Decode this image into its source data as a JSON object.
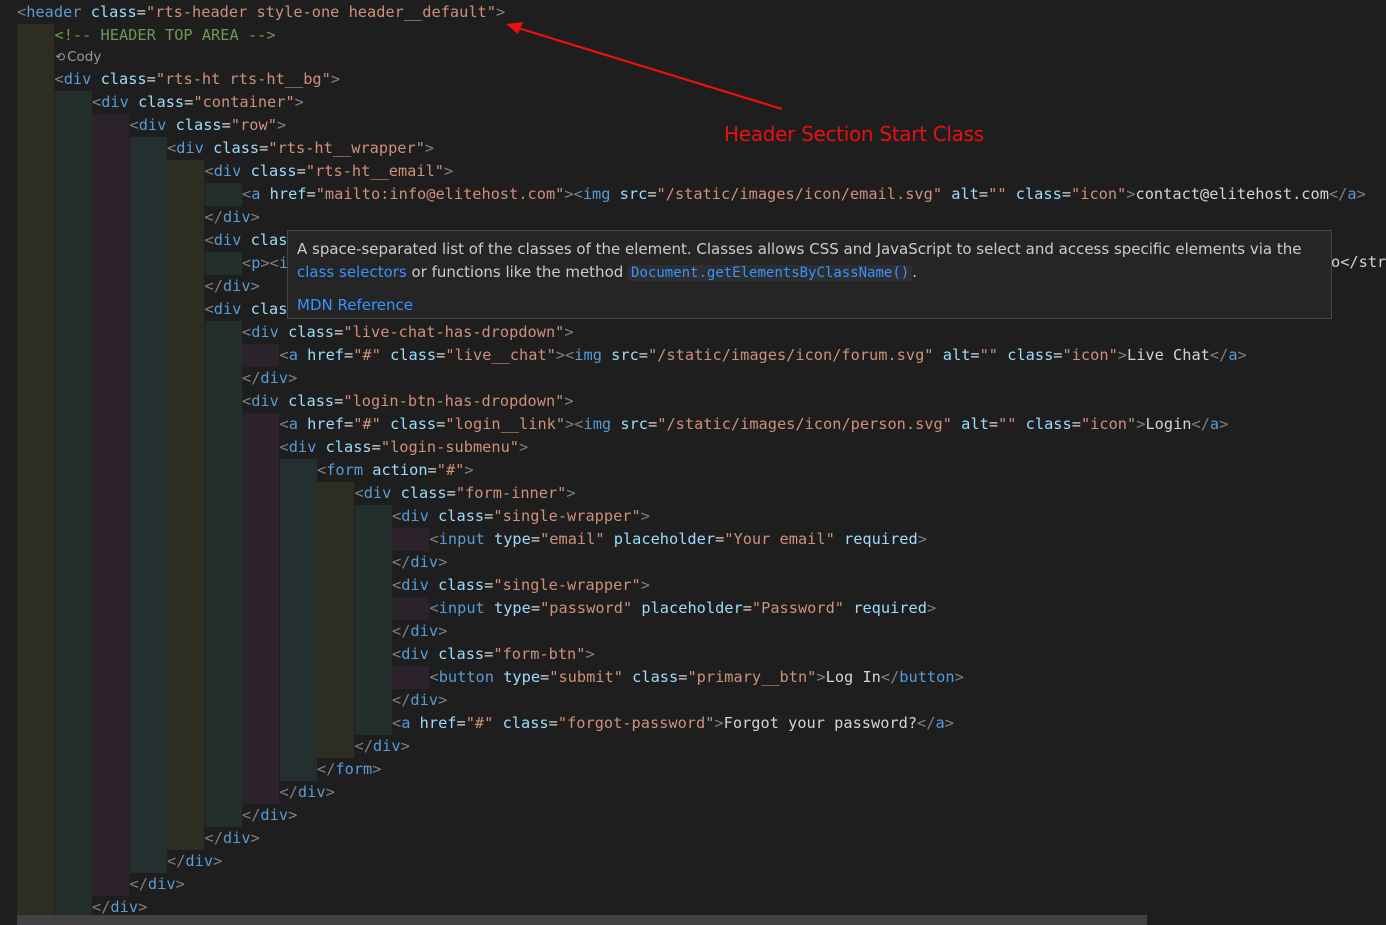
{
  "code_lines": [
    {
      "indent": 0,
      "tokens": [
        [
          "b",
          "<"
        ],
        [
          "t",
          "header"
        ],
        [
          "x",
          " "
        ],
        [
          "a",
          "class"
        ],
        [
          "x",
          "="
        ],
        [
          "s",
          "\"rts-header style-one header__default\""
        ],
        [
          "b",
          ">"
        ]
      ]
    },
    {
      "indent": 1,
      "tokens": [
        [
          "c",
          "<!-- HEADER TOP AREA -->"
        ]
      ]
    },
    {
      "indent": 1,
      "tokens": [
        [
          "b",
          "<"
        ],
        [
          "t",
          "div"
        ],
        [
          "x",
          " "
        ],
        [
          "a",
          "class"
        ],
        [
          "x",
          "="
        ],
        [
          "s",
          "\"rts-ht rts-ht__bg\""
        ],
        [
          "b",
          ">"
        ]
      ]
    },
    {
      "indent": 2,
      "tokens": [
        [
          "b",
          "<"
        ],
        [
          "t",
          "div"
        ],
        [
          "x",
          " "
        ],
        [
          "a",
          "class"
        ],
        [
          "x",
          "="
        ],
        [
          "s",
          "\"container\""
        ],
        [
          "b",
          ">"
        ]
      ]
    },
    {
      "indent": 3,
      "tokens": [
        [
          "b",
          "<"
        ],
        [
          "t",
          "div"
        ],
        [
          "x",
          " "
        ],
        [
          "a",
          "class"
        ],
        [
          "x",
          "="
        ],
        [
          "s",
          "\"row\""
        ],
        [
          "b",
          ">"
        ]
      ]
    },
    {
      "indent": 4,
      "tokens": [
        [
          "b",
          "<"
        ],
        [
          "t",
          "div"
        ],
        [
          "x",
          " "
        ],
        [
          "a",
          "class"
        ],
        [
          "x",
          "="
        ],
        [
          "s",
          "\"rts-ht__wrapper\""
        ],
        [
          "b",
          ">"
        ]
      ]
    },
    {
      "indent": 5,
      "tokens": [
        [
          "b",
          "<"
        ],
        [
          "t",
          "div"
        ],
        [
          "x",
          " "
        ],
        [
          "a",
          "class"
        ],
        [
          "x",
          "="
        ],
        [
          "s",
          "\"rts-ht__email\""
        ],
        [
          "b",
          ">"
        ]
      ]
    },
    {
      "indent": 6,
      "tokens": [
        [
          "b",
          "<"
        ],
        [
          "t",
          "a"
        ],
        [
          "x",
          " "
        ],
        [
          "a",
          "href"
        ],
        [
          "x",
          "="
        ],
        [
          "s",
          "\"mailto:info@elitehost.com\""
        ],
        [
          "b",
          "><"
        ],
        [
          "t",
          "img"
        ],
        [
          "x",
          " "
        ],
        [
          "a",
          "src"
        ],
        [
          "x",
          "="
        ],
        [
          "s",
          "\"/static/images/icon/email.svg\""
        ],
        [
          "x",
          " "
        ],
        [
          "a",
          "alt"
        ],
        [
          "x",
          "="
        ],
        [
          "s",
          "\"\""
        ],
        [
          "x",
          " "
        ],
        [
          "a",
          "class"
        ],
        [
          "x",
          "="
        ],
        [
          "s",
          "\"icon\""
        ],
        [
          "b",
          ">"
        ],
        [
          "e",
          "contact@elitehost.com"
        ],
        [
          "b",
          "</"
        ],
        [
          "t",
          "a"
        ],
        [
          "b",
          ">"
        ]
      ]
    },
    {
      "indent": 5,
      "tokens": [
        [
          "b",
          "</"
        ],
        [
          "t",
          "div"
        ],
        [
          "b",
          ">"
        ]
      ]
    },
    {
      "indent": 5,
      "tokens": [
        [
          "b",
          "<"
        ],
        [
          "t",
          "div"
        ],
        [
          "x",
          " "
        ],
        [
          "a",
          "clas"
        ]
      ]
    },
    {
      "indent": 6,
      "tokens": [
        [
          "b",
          "<"
        ],
        [
          "t",
          "p"
        ],
        [
          "b",
          "><"
        ],
        [
          "t",
          "i"
        ]
      ]
    },
    {
      "indent": 5,
      "tokens": [
        [
          "b",
          "</"
        ],
        [
          "t",
          "div"
        ],
        [
          "b",
          ">"
        ]
      ]
    },
    {
      "indent": 5,
      "tokens": [
        [
          "b",
          "<"
        ],
        [
          "t",
          "div"
        ],
        [
          "x",
          " "
        ],
        [
          "a",
          "clas"
        ]
      ]
    },
    {
      "indent": 6,
      "tokens": [
        [
          "b",
          "<"
        ],
        [
          "t",
          "div"
        ],
        [
          "x",
          " "
        ],
        [
          "a",
          "class"
        ],
        [
          "x",
          "="
        ],
        [
          "s",
          "\"live-chat-has-dropdown\""
        ],
        [
          "b",
          ">"
        ]
      ]
    },
    {
      "indent": 7,
      "tokens": [
        [
          "b",
          "<"
        ],
        [
          "t",
          "a"
        ],
        [
          "x",
          " "
        ],
        [
          "a",
          "href"
        ],
        [
          "x",
          "="
        ],
        [
          "s",
          "\"#\""
        ],
        [
          "x",
          " "
        ],
        [
          "a",
          "class"
        ],
        [
          "x",
          "="
        ],
        [
          "s",
          "\"live__chat\""
        ],
        [
          "b",
          "><"
        ],
        [
          "t",
          "img"
        ],
        [
          "x",
          " "
        ],
        [
          "a",
          "src"
        ],
        [
          "x",
          "="
        ],
        [
          "s",
          "\"/static/images/icon/forum.svg\""
        ],
        [
          "x",
          " "
        ],
        [
          "a",
          "alt"
        ],
        [
          "x",
          "="
        ],
        [
          "s",
          "\"\""
        ],
        [
          "x",
          " "
        ],
        [
          "a",
          "class"
        ],
        [
          "x",
          "="
        ],
        [
          "s",
          "\"icon\""
        ],
        [
          "b",
          ">"
        ],
        [
          "e",
          "Live Chat"
        ],
        [
          "b",
          "</"
        ],
        [
          "t",
          "a"
        ],
        [
          "b",
          ">"
        ]
      ]
    },
    {
      "indent": 6,
      "tokens": [
        [
          "b",
          "</"
        ],
        [
          "t",
          "div"
        ],
        [
          "b",
          ">"
        ]
      ]
    },
    {
      "indent": 6,
      "tokens": [
        [
          "b",
          "<"
        ],
        [
          "t",
          "div"
        ],
        [
          "x",
          " "
        ],
        [
          "a",
          "class"
        ],
        [
          "x",
          "="
        ],
        [
          "s",
          "\"login-btn-has-dropdown\""
        ],
        [
          "b",
          ">"
        ]
      ]
    },
    {
      "indent": 7,
      "tokens": [
        [
          "b",
          "<"
        ],
        [
          "t",
          "a"
        ],
        [
          "x",
          " "
        ],
        [
          "a",
          "href"
        ],
        [
          "x",
          "="
        ],
        [
          "s",
          "\"#\""
        ],
        [
          "x",
          " "
        ],
        [
          "a",
          "class"
        ],
        [
          "x",
          "="
        ],
        [
          "s",
          "\"login__link\""
        ],
        [
          "b",
          "><"
        ],
        [
          "t",
          "img"
        ],
        [
          "x",
          " "
        ],
        [
          "a",
          "src"
        ],
        [
          "x",
          "="
        ],
        [
          "s",
          "\"/static/images/icon/person.svg\""
        ],
        [
          "x",
          " "
        ],
        [
          "a",
          "alt"
        ],
        [
          "x",
          "="
        ],
        [
          "s",
          "\"\""
        ],
        [
          "x",
          " "
        ],
        [
          "a",
          "class"
        ],
        [
          "x",
          "="
        ],
        [
          "s",
          "\"icon\""
        ],
        [
          "b",
          ">"
        ],
        [
          "e",
          "Login"
        ],
        [
          "b",
          "</"
        ],
        [
          "t",
          "a"
        ],
        [
          "b",
          ">"
        ]
      ]
    },
    {
      "indent": 7,
      "tokens": [
        [
          "b",
          "<"
        ],
        [
          "t",
          "div"
        ],
        [
          "x",
          " "
        ],
        [
          "a",
          "class"
        ],
        [
          "x",
          "="
        ],
        [
          "s",
          "\"login-submenu\""
        ],
        [
          "b",
          ">"
        ]
      ]
    },
    {
      "indent": 8,
      "tokens": [
        [
          "b",
          "<"
        ],
        [
          "t",
          "form"
        ],
        [
          "x",
          " "
        ],
        [
          "a",
          "action"
        ],
        [
          "x",
          "="
        ],
        [
          "s",
          "\"#\""
        ],
        [
          "b",
          ">"
        ]
      ]
    },
    {
      "indent": 9,
      "tokens": [
        [
          "b",
          "<"
        ],
        [
          "t",
          "div"
        ],
        [
          "x",
          " "
        ],
        [
          "a",
          "class"
        ],
        [
          "x",
          "="
        ],
        [
          "s",
          "\"form-inner\""
        ],
        [
          "b",
          ">"
        ]
      ]
    },
    {
      "indent": 10,
      "tokens": [
        [
          "b",
          "<"
        ],
        [
          "t",
          "div"
        ],
        [
          "x",
          " "
        ],
        [
          "a",
          "class"
        ],
        [
          "x",
          "="
        ],
        [
          "s",
          "\"single-wrapper\""
        ],
        [
          "b",
          ">"
        ]
      ]
    },
    {
      "indent": 11,
      "tokens": [
        [
          "b",
          "<"
        ],
        [
          "t",
          "input"
        ],
        [
          "x",
          " "
        ],
        [
          "a",
          "type"
        ],
        [
          "x",
          "="
        ],
        [
          "s",
          "\"email\""
        ],
        [
          "x",
          " "
        ],
        [
          "a",
          "placeholder"
        ],
        [
          "x",
          "="
        ],
        [
          "s",
          "\"Your email\""
        ],
        [
          "x",
          " "
        ],
        [
          "a",
          "required"
        ],
        [
          "b",
          ">"
        ]
      ]
    },
    {
      "indent": 10,
      "tokens": [
        [
          "b",
          "</"
        ],
        [
          "t",
          "div"
        ],
        [
          "b",
          ">"
        ]
      ]
    },
    {
      "indent": 10,
      "tokens": [
        [
          "b",
          "<"
        ],
        [
          "t",
          "div"
        ],
        [
          "x",
          " "
        ],
        [
          "a",
          "class"
        ],
        [
          "x",
          "="
        ],
        [
          "s",
          "\"single-wrapper\""
        ],
        [
          "b",
          ">"
        ]
      ]
    },
    {
      "indent": 11,
      "tokens": [
        [
          "b",
          "<"
        ],
        [
          "t",
          "input"
        ],
        [
          "x",
          " "
        ],
        [
          "a",
          "type"
        ],
        [
          "x",
          "="
        ],
        [
          "s",
          "\"password\""
        ],
        [
          "x",
          " "
        ],
        [
          "a",
          "placeholder"
        ],
        [
          "x",
          "="
        ],
        [
          "s",
          "\"Password\""
        ],
        [
          "x",
          " "
        ],
        [
          "a",
          "required"
        ],
        [
          "b",
          ">"
        ]
      ]
    },
    {
      "indent": 10,
      "tokens": [
        [
          "b",
          "</"
        ],
        [
          "t",
          "div"
        ],
        [
          "b",
          ">"
        ]
      ]
    },
    {
      "indent": 10,
      "tokens": [
        [
          "b",
          "<"
        ],
        [
          "t",
          "div"
        ],
        [
          "x",
          " "
        ],
        [
          "a",
          "class"
        ],
        [
          "x",
          "="
        ],
        [
          "s",
          "\"form-btn\""
        ],
        [
          "b",
          ">"
        ]
      ]
    },
    {
      "indent": 11,
      "tokens": [
        [
          "b",
          "<"
        ],
        [
          "t",
          "button"
        ],
        [
          "x",
          " "
        ],
        [
          "a",
          "type"
        ],
        [
          "x",
          "="
        ],
        [
          "s",
          "\"submit\""
        ],
        [
          "x",
          " "
        ],
        [
          "a",
          "class"
        ],
        [
          "x",
          "="
        ],
        [
          "s",
          "\"primary__btn\""
        ],
        [
          "b",
          ">"
        ],
        [
          "e",
          "Log In"
        ],
        [
          "b",
          "</"
        ],
        [
          "t",
          "button"
        ],
        [
          "b",
          ">"
        ]
      ]
    },
    {
      "indent": 10,
      "tokens": [
        [
          "b",
          "</"
        ],
        [
          "t",
          "div"
        ],
        [
          "b",
          ">"
        ]
      ]
    },
    {
      "indent": 10,
      "tokens": [
        [
          "b",
          "<"
        ],
        [
          "t",
          "a"
        ],
        [
          "x",
          " "
        ],
        [
          "a",
          "href"
        ],
        [
          "x",
          "="
        ],
        [
          "s",
          "\"#\""
        ],
        [
          "x",
          " "
        ],
        [
          "a",
          "class"
        ],
        [
          "x",
          "="
        ],
        [
          "s",
          "\"forgot-password\""
        ],
        [
          "b",
          ">"
        ],
        [
          "e",
          "Forgot your password?"
        ],
        [
          "b",
          "</"
        ],
        [
          "t",
          "a"
        ],
        [
          "b",
          ">"
        ]
      ]
    },
    {
      "indent": 9,
      "tokens": [
        [
          "b",
          "</"
        ],
        [
          "t",
          "div"
        ],
        [
          "b",
          ">"
        ]
      ]
    },
    {
      "indent": 8,
      "tokens": [
        [
          "b",
          "</"
        ],
        [
          "t",
          "form"
        ],
        [
          "b",
          ">"
        ]
      ]
    },
    {
      "indent": 7,
      "tokens": [
        [
          "b",
          "</"
        ],
        [
          "t",
          "div"
        ],
        [
          "b",
          ">"
        ]
      ]
    },
    {
      "indent": 6,
      "tokens": [
        [
          "b",
          "</"
        ],
        [
          "t",
          "div"
        ],
        [
          "b",
          ">"
        ]
      ]
    },
    {
      "indent": 5,
      "tokens": [
        [
          "b",
          "</"
        ],
        [
          "t",
          "div"
        ],
        [
          "b",
          ">"
        ]
      ]
    },
    {
      "indent": 4,
      "tokens": [
        [
          "b",
          "</"
        ],
        [
          "t",
          "div"
        ],
        [
          "b",
          ">"
        ]
      ]
    },
    {
      "indent": 3,
      "tokens": [
        [
          "b",
          "</"
        ],
        [
          "t",
          "div"
        ],
        [
          "b",
          ">"
        ]
      ]
    },
    {
      "indent": 2,
      "tokens": [
        [
          "b",
          "</"
        ],
        [
          "t",
          "div"
        ],
        [
          "b",
          ">"
        ]
      ]
    }
  ],
  "codelens": {
    "icon": "codelens-icon",
    "label": "Cody"
  },
  "clipped_right_text": "o</str",
  "tooltip": {
    "text_1": "A space-separated list of the classes of the element. Classes allows CSS and JavaScript to select and access specific elements via the ",
    "link_1": "class selectors",
    "text_2": " or functions like the method ",
    "code": "Document.getElementsByClassName()",
    "text_3": ".",
    "reference_link": "MDN Reference"
  },
  "annotation": {
    "label": "Header Section Start Class",
    "color": "#e81010"
  },
  "theme": {
    "background": "#1e1e1e",
    "indent_guides": [
      "#2d2d22",
      "#232f2a",
      "#2c222b",
      "#243030"
    ]
  }
}
